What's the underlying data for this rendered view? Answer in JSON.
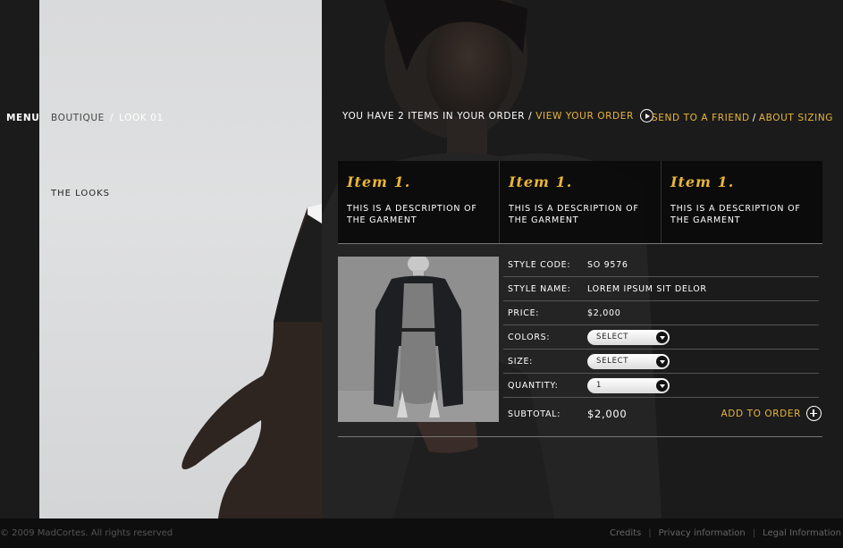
{
  "nav": {
    "menu_label": "MENU",
    "breadcrumb": {
      "root": "BOUTIQUE",
      "separator": "/",
      "current": "LOOK 01"
    },
    "section_label": "THE LOOKS"
  },
  "order": {
    "summary_text": "YOU HAVE 2 ITEMS IN YOUR ORDER /",
    "view_link": "VIEW YOUR ORDER",
    "send_link": "SEND TO A FRIEND",
    "separator": "/",
    "sizing_link": "ABOUT SIZING"
  },
  "items": [
    {
      "title": "Item 1.",
      "description": "THIS IS A DESCRIPTION OF THE GARMENT"
    },
    {
      "title": "Item 1.",
      "description": "THIS IS A DESCRIPTION OF THE GARMENT"
    },
    {
      "title": "Item 1.",
      "description": "THIS IS A DESCRIPTION OF THE GARMENT"
    }
  ],
  "product": {
    "style_code_label": "STYLE CODE:",
    "style_code": "SO 9576",
    "style_name_label": "STYLE NAME:",
    "style_name": "LOREM IPSUM SIT DELOR",
    "price_label": "PRICE:",
    "price": "$2,000",
    "colors_label": "COLORS:",
    "colors_value": "SELECT",
    "size_label": "SIZE:",
    "size_value": "SELECT",
    "quantity_label": "QUANTITY:",
    "quantity_value": "1",
    "subtotal_label": "SUBTOTAL:",
    "subtotal": "$2,000",
    "add_to_order": "ADD TO ORDER"
  },
  "footer": {
    "copyright": "© 2009 MadCortes. All rights reserved",
    "links": [
      "Credits",
      "Privacy information",
      "Legal Information"
    ]
  },
  "colors": {
    "accent": "#e8b53b",
    "background": "#1b1b1b",
    "panel": "#dcdcdd"
  },
  "icons": [
    "play-circle-icon",
    "plus-circle-icon",
    "dropdown-arrow-icon"
  ]
}
